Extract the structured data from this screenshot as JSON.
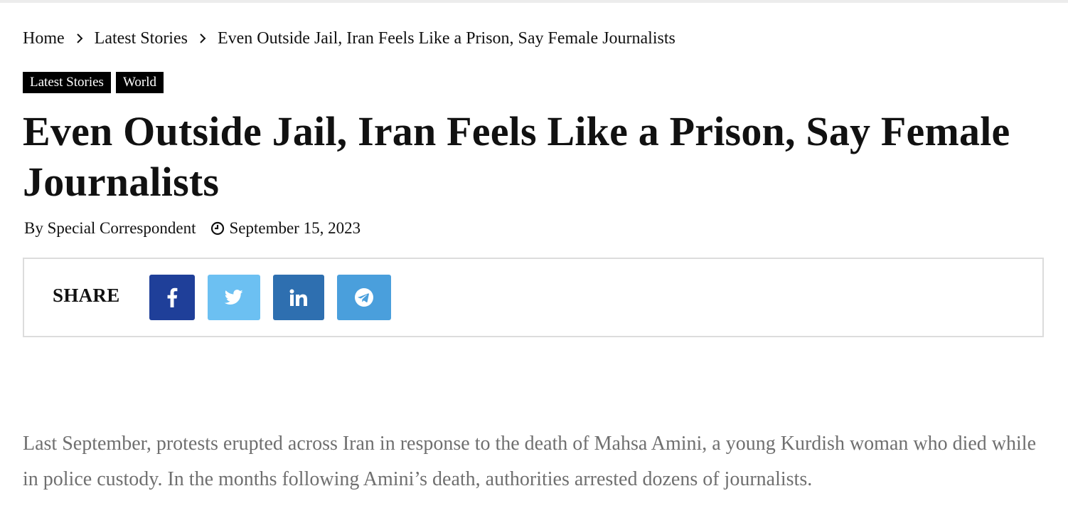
{
  "breadcrumb": {
    "home": "Home",
    "section": "Latest Stories",
    "current": "Even Outside Jail, Iran Feels Like a Prison, Say Female Journalists"
  },
  "tags": [
    "Latest Stories",
    "World"
  ],
  "article": {
    "title": "Even Outside Jail, Iran Feels Like a Prison, Say Female Journalists",
    "byline": "By Special Correspondent",
    "date": "September 15, 2023",
    "first_paragraph": "Last September, protests erupted across Iran in response to the death of Mahsa Amini, a young Kurdish woman who died while in police custody. In the months following Amini’s death, authorities arrested dozens of journalists."
  },
  "share": {
    "label": "SHARE",
    "buttons": [
      {
        "name": "facebook",
        "icon": "facebook-icon",
        "color": "#1f3f99"
      },
      {
        "name": "twitter",
        "icon": "twitter-icon",
        "color": "#6cc0f2"
      },
      {
        "name": "linkedin",
        "icon": "linkedin-icon",
        "color": "#2e6fb0"
      },
      {
        "name": "telegram",
        "icon": "telegram-icon",
        "color": "#4a9fdc"
      }
    ]
  },
  "colors": {
    "tag_bg": "#000000",
    "body_text": "#6f6f6f",
    "border": "#dcdcdc"
  }
}
